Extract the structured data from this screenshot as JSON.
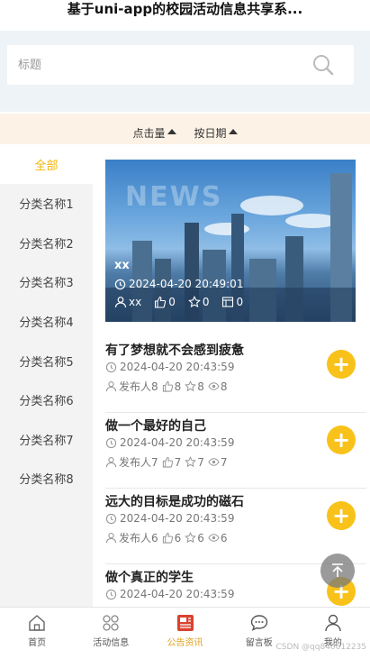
{
  "header": {
    "title": "基于uni-app的校园活动信息共享系..."
  },
  "search": {
    "placeholder": "标题"
  },
  "sort": {
    "clicks_label": "点击量",
    "date_label": "按日期"
  },
  "sidebar": {
    "items": [
      {
        "label": "全部",
        "active": true
      },
      {
        "label": "分类名称1"
      },
      {
        "label": "分类名称2"
      },
      {
        "label": "分类名称3"
      },
      {
        "label": "分类名称4"
      },
      {
        "label": "分类名称5"
      },
      {
        "label": "分类名称6"
      },
      {
        "label": "分类名称7"
      },
      {
        "label": "分类名称8"
      }
    ]
  },
  "banner": {
    "image_text": "NEWS",
    "title": "xx",
    "time": "2024-04-20 20:49:01",
    "author": "xx",
    "likes": "0",
    "stars": "0",
    "views": "0"
  },
  "list": [
    {
      "title": "有了梦想就不会感到疲惫",
      "time": "2024-04-20 20:43:59",
      "author": "发布人8",
      "likes": "8",
      "stars": "8",
      "views": "8"
    },
    {
      "title": "做一个最好的自己",
      "time": "2024-04-20 20:43:59",
      "author": "发布人7",
      "likes": "7",
      "stars": "7",
      "views": "7"
    },
    {
      "title": "远大的目标是成功的磁石",
      "time": "2024-04-20 20:43:59",
      "author": "发布人6",
      "likes": "6",
      "stars": "6",
      "views": "6"
    },
    {
      "title": "做个真正的学生",
      "time": "2024-04-20 20:43:59",
      "author": "",
      "likes": "",
      "stars": "",
      "views": ""
    }
  ],
  "add_button": "+",
  "tabbar": {
    "items": [
      {
        "label": "首页",
        "icon": "home-icon"
      },
      {
        "label": "活动信息",
        "icon": "grid-icon"
      },
      {
        "label": "公告资讯",
        "icon": "news-icon",
        "active": true
      },
      {
        "label": "留言板",
        "icon": "chat-icon"
      },
      {
        "label": "我的",
        "icon": "user-icon"
      }
    ]
  },
  "watermark": "CSDN @qq840612235",
  "colors": {
    "accent": "#f8c21a",
    "active_tab": "#e0a11b",
    "sort_bg": "#fdf2e6",
    "search_bg": "#eef3f7",
    "sidebar_bg": "#f3f3f3"
  }
}
